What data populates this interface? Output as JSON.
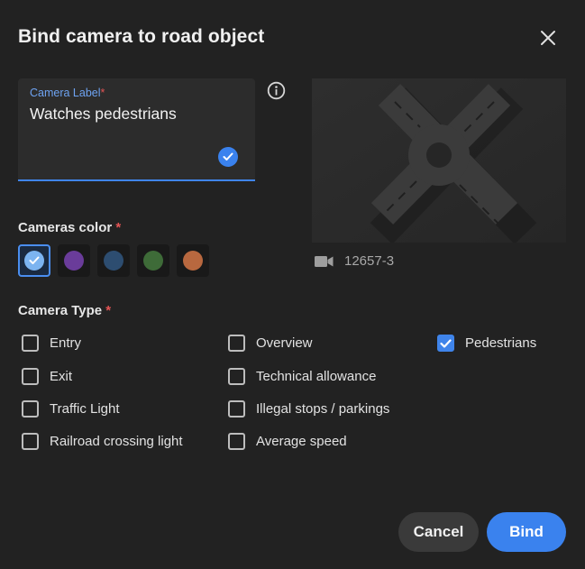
{
  "dialog": {
    "title": "Bind camera to road object"
  },
  "camera_label_field": {
    "label": "Camera Label",
    "required_mark": "*",
    "value": "Watches pedestrians"
  },
  "preview": {
    "camera_id": "12657-3"
  },
  "cameras_color": {
    "label": "Cameras color",
    "required_mark": "*",
    "options": [
      {
        "color": "#7cb4f0",
        "selected": true
      },
      {
        "color": "#6a3c9a",
        "selected": false
      },
      {
        "color": "#2d4d70",
        "selected": false
      },
      {
        "color": "#3e6b38",
        "selected": false
      },
      {
        "color": "#b8683f",
        "selected": false
      }
    ]
  },
  "camera_type": {
    "label": "Camera Type",
    "required_mark": "*",
    "options": [
      {
        "label": "Entry",
        "checked": false
      },
      {
        "label": "Exit",
        "checked": false
      },
      {
        "label": "Traffic Light",
        "checked": false
      },
      {
        "label": "Railroad crossing light",
        "checked": false
      },
      {
        "label": "Overview",
        "checked": false
      },
      {
        "label": "Technical allowance",
        "checked": false
      },
      {
        "label": "Illegal stops / parkings",
        "checked": false
      },
      {
        "label": "Average speed",
        "checked": false
      },
      {
        "label": "Pedestrians",
        "checked": true
      }
    ]
  },
  "actions": {
    "cancel_label": "Cancel",
    "bind_label": "Bind"
  },
  "colors": {
    "accent": "#3a82ee",
    "required": "#e35454"
  }
}
